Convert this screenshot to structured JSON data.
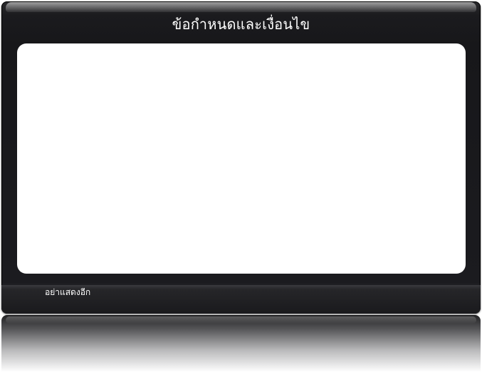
{
  "dialog": {
    "title": "ข้อกำหนดและเงื่อนไข",
    "content_text": "",
    "dont_show_again_label": "อย่าแสดงอีก"
  },
  "colors": {
    "frame": "#18181b",
    "title_text": "#ffffff",
    "content_background": "#ffffff"
  }
}
